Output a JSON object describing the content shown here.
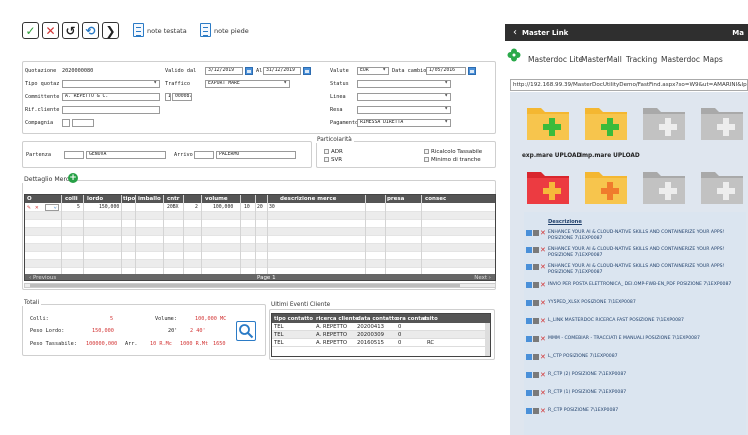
{
  "toolbar": {
    "buttons": [
      {
        "name": "confirm-button",
        "glyph": "✓",
        "color": "#2e9e3a"
      },
      {
        "name": "cancel-button",
        "glyph": "✕",
        "color": "#d23232"
      },
      {
        "name": "undo-button",
        "glyph": "↺",
        "color": "#222222"
      },
      {
        "name": "refresh-button",
        "glyph": "⟲",
        "color": "#2b7bc6"
      },
      {
        "name": "next-button",
        "glyph": "❯",
        "color": "#222222"
      }
    ],
    "note_testata": "note testata",
    "note_piede": "note piede"
  },
  "header_form": {
    "quotazione_label": "Quotazione",
    "quotazione_value": "2020000080",
    "valido_label": "Valido dal",
    "valido_from": "3/12/2019",
    "al_label": "Al",
    "valido_to": "31/12/2019",
    "valuta_label": "Valute",
    "valuta_value": "EUR",
    "data_cambio_label": "Data cambio",
    "data_cambio_value": "1/05/2016",
    "tipo_quotaz_label": "Tipo quotaz",
    "traffico_label": "Traffico",
    "traffico_value": "EXPORT MARE",
    "status_label": "Status",
    "committente_label": "Committente",
    "committente_value": "A. REPETTO & C.",
    "committente_num": "1",
    "committente_code": "000087",
    "linea_label": "Linea",
    "rif_cliente_label": "Rif.cliente",
    "resa_label": "Resa",
    "compagnia_label": "Compagnia",
    "pagamento_label": "Pagamento",
    "pagamento_value": "RIMESSA DIRETTA"
  },
  "route": {
    "partenza_label": "Partenza",
    "partenza_value": "GENOVA",
    "arrivo_label": "Arrivo",
    "arrivo_value": "PALERMO",
    "particolarita_title": "Particolarità",
    "adr": "ADR",
    "svr": "SVR",
    "ricalcolo": "Ricalcolo Tassabile",
    "minimo": "Minimo di tranche"
  },
  "merce": {
    "title": "Dettaglio Merce",
    "columns": [
      "O",
      "colli",
      "lordo",
      "tipo",
      "imballo",
      "cntr",
      "volume",
      "descrizione merce",
      "presa",
      "consec"
    ],
    "row": {
      "colli": "5",
      "lordo": "150,000",
      "cntr": "20BX",
      "volume_n": "2",
      "volume": "100,000",
      "a": "10",
      "b": "20",
      "c": "30"
    },
    "prev": "Previous",
    "page": "Page 1",
    "next": "Next"
  },
  "totali": {
    "title": "Totali",
    "colli_label": "Colli:",
    "colli_value": "5",
    "volume_label": "Volume:",
    "volume_value": "100,000 MC",
    "peso_lordo_label": "Peso Lordo:",
    "peso_lordo_value": "150,000",
    "vol_20": "20'",
    "vol_40": "2 40'",
    "peso_tass_label": "Peso Tassabile:",
    "peso_tass_value": "100000,000",
    "arr_label": "Arr.",
    "arr_rmc": "10 R.Mc",
    "arr_rmt": "1000 R.Mt",
    "arr_num": "1650"
  },
  "eventi": {
    "title": "Ultimi Eventi Cliente",
    "columns": [
      "tipo contatto",
      "ricerca cliente",
      "data contatto",
      "ora contat",
      "esito"
    ],
    "rows": [
      [
        "TEL",
        "A. REPETTO",
        "20200413",
        "0",
        ""
      ],
      [
        "TEL",
        "A. REPETTO",
        "20200309",
        "0",
        ""
      ],
      [
        "TEL",
        "A. REPETTO",
        "20160515",
        "0",
        "RC"
      ]
    ]
  },
  "right": {
    "title": "Master Link",
    "title_right": "Ma",
    "tabs": [
      "Masterdoc Lite",
      "MasterMall",
      "Tracking",
      "Masterdoc",
      "Maps"
    ],
    "url": "http://192.168.99.39/MasterDocUtilityDemo/FastFind.aspx?so=W9&ut=AMARINI&lpn=Posizi",
    "folders": [
      {
        "label": "exp.mare UPLOAD",
        "color": "#f4b731"
      },
      {
        "label": "imp.mare UPLOAD",
        "color": "#f4b731"
      },
      {
        "label": "",
        "color": "#b9b9b9"
      },
      {
        "label": "",
        "color": "#b9b9b9"
      },
      {
        "label": "",
        "color": "#e8363c"
      },
      {
        "label": "",
        "color": "#f4b731"
      },
      {
        "label": "",
        "color": "#b9b9b9"
      },
      {
        "label": "",
        "color": "#b9b9b9"
      }
    ],
    "list_header": "Descrizione",
    "docs": [
      "ENHANCE YOUR AI & CLOUD-NATIVE SKILLS AND CONTAINERIZE YOUR APPS! POSIZIONE 7\\1EXP0087",
      "ENHANCE YOUR AI & CLOUD-NATIVE SKILLS AND CONTAINERIZE YOUR APPS! POSIZIONE 7\\1EXP0087",
      "ENHANCE YOUR AI & CLOUD-NATIVE SKILLS AND CONTAINERIZE YOUR APPS! POSIZIONE 7\\1EXP0087",
      "INVIO PER POSTA ELETTRONICA_ DEI.OMP-FWB-EN_PDF POSIZIONE 7\\1EXP0087",
      "YY5PED_XLSX POSIZIONE 7\\1EXP0087",
      "L_LINK MASTERDOC RICERCA FAST POSIZIONE 7\\1EXP0087",
      "MMM - COMEBIAR - TRACCIATI E MANUALI POSIZIONE 7\\1EXP0087",
      "L_CTP POSIZIONE 7\\1EXP0087",
      "R_CTP (2) POSIZIONE 7\\1EXP0087",
      "R_CTP (1) POSIZIONE 7\\1EXP0087",
      "R_CTP POSIZIONE 7\\1EXP0087"
    ]
  }
}
